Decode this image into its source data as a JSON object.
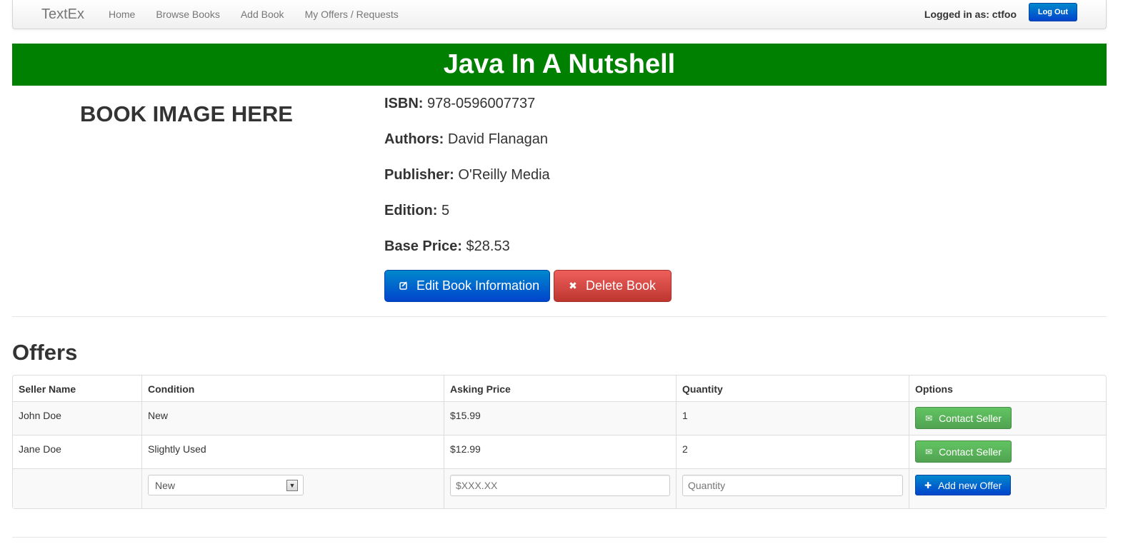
{
  "navbar": {
    "brand": "TextEx",
    "links": [
      "Home",
      "Browse Books",
      "Add Book",
      "My Offers / Requests"
    ],
    "logged_in": "Logged in as: ctfoo",
    "logout": "Log Out"
  },
  "book": {
    "title": "Java In A Nutshell",
    "image_placeholder": "BOOK IMAGE HERE",
    "fields": [
      {
        "label": "ISBN:",
        "value": "978-0596007737"
      },
      {
        "label": "Authors:",
        "value": "David Flanagan"
      },
      {
        "label": "Publisher:",
        "value": "O'Reilly Media"
      },
      {
        "label": "Edition:",
        "value": "5"
      },
      {
        "label": "Base Price:",
        "value": "$28.53"
      }
    ],
    "edit_button": "Edit Book Information",
    "delete_button": "Delete Book"
  },
  "offers": {
    "heading": "Offers",
    "columns": [
      "Seller Name",
      "Condition",
      "Asking Price",
      "Quantity",
      "Options"
    ],
    "rows": [
      {
        "seller": "John Doe",
        "condition": "New",
        "price": "$15.99",
        "quantity": "1",
        "action": "Contact Seller"
      },
      {
        "seller": "Jane Doe",
        "condition": "Slightly Used",
        "price": "$12.99",
        "quantity": "2",
        "action": "Contact Seller"
      }
    ],
    "new_offer": {
      "condition_selected": "New",
      "price_placeholder": "$XXX.XX",
      "quantity_placeholder": "Quantity",
      "add_button": "Add new Offer"
    }
  },
  "icons": {
    "edit": "edit-icon",
    "delete": "remove-icon",
    "contact": "envelope-icon",
    "add": "plus-icon"
  },
  "colors": {
    "title_banner": "#008000",
    "primary": "#0055cc",
    "danger": "#da4f49",
    "success": "#5bb75b"
  }
}
